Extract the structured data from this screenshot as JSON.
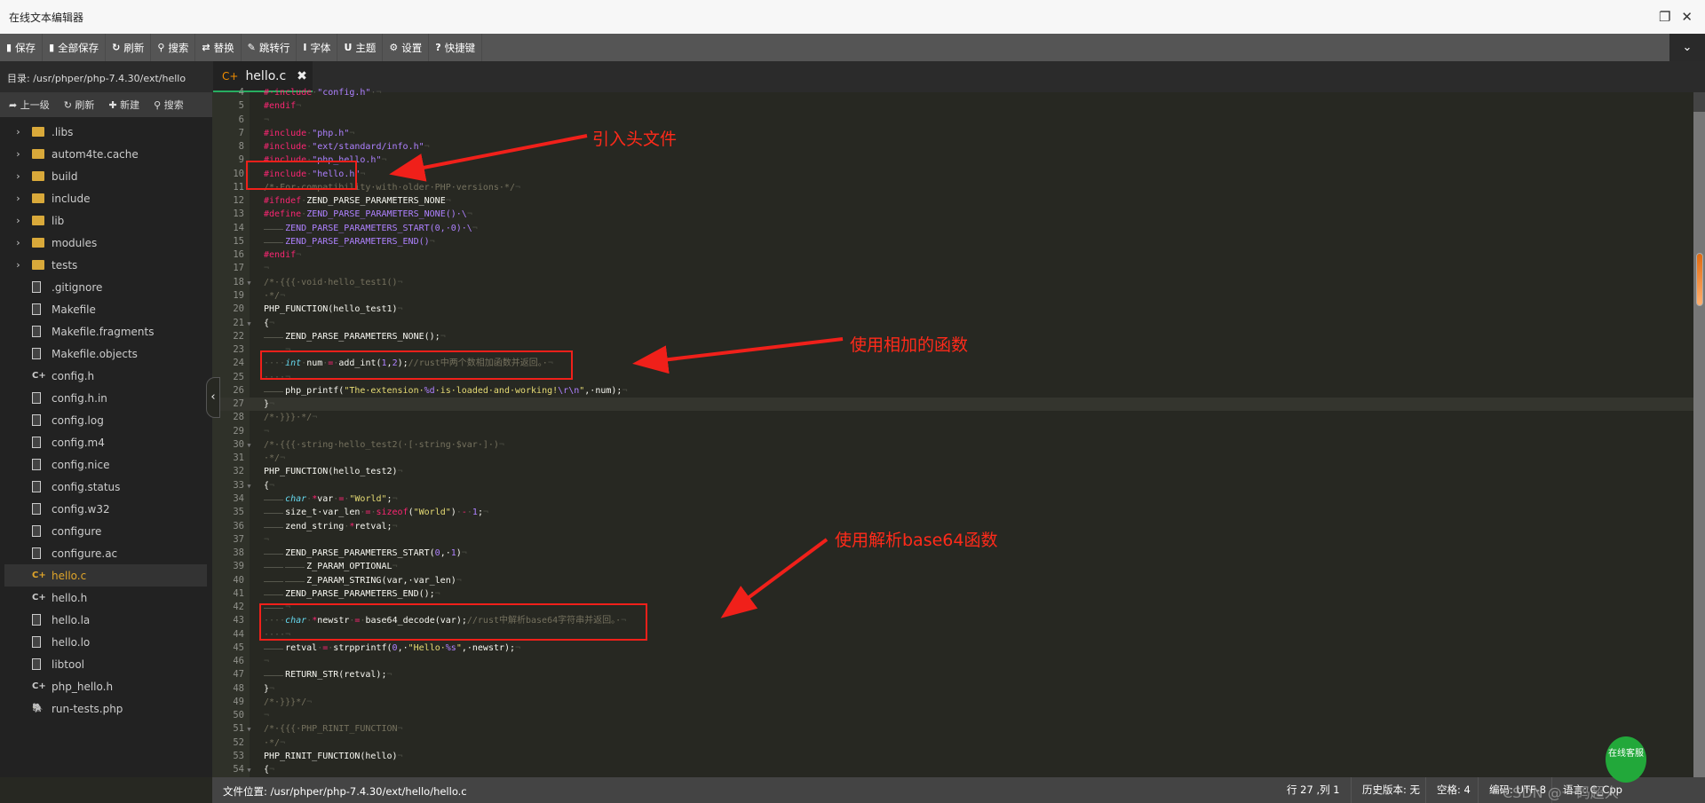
{
  "window": {
    "title": "在线文本编辑器",
    "restore_icon": "restore-icon",
    "close_icon": "close-icon"
  },
  "toolbar": [
    {
      "icon": "save-icon",
      "glyph": "▮",
      "label": "保存"
    },
    {
      "icon": "save-all-icon",
      "glyph": "▮",
      "label": "全部保存"
    },
    {
      "icon": "refresh-icon",
      "glyph": "↻",
      "label": "刷新"
    },
    {
      "icon": "search-icon",
      "glyph": "⚲",
      "label": "搜索"
    },
    {
      "icon": "replace-icon",
      "glyph": "⇄",
      "label": "替换"
    },
    {
      "icon": "pin-icon",
      "glyph": "✎",
      "label": "跳转行"
    },
    {
      "icon": "font-icon",
      "glyph": "I",
      "label": "字体"
    },
    {
      "icon": "magnet-icon",
      "glyph": "U",
      "label": "主题"
    },
    {
      "icon": "gear-icon",
      "glyph": "⚙",
      "label": "设置"
    },
    {
      "icon": "help-icon",
      "glyph": "?",
      "label": "快捷键"
    }
  ],
  "sidebar": {
    "directory": "目录: /usr/phper/php-7.4.30/ext/hello",
    "tools": [
      {
        "icon": "up-icon",
        "label": "➦ 上一级"
      },
      {
        "icon": "refresh-icon",
        "label": "↻ 刷新"
      },
      {
        "icon": "plus-icon",
        "label": "✚ 新建"
      },
      {
        "icon": "search-icon",
        "label": "⚲ 搜索"
      }
    ],
    "items": [
      {
        "name": ".libs",
        "type": "folder"
      },
      {
        "name": "autom4te.cache",
        "type": "folder"
      },
      {
        "name": "build",
        "type": "folder"
      },
      {
        "name": "include",
        "type": "folder"
      },
      {
        "name": "lib",
        "type": "folder"
      },
      {
        "name": "modules",
        "type": "folder"
      },
      {
        "name": "tests",
        "type": "folder"
      },
      {
        "name": ".gitignore",
        "type": "file"
      },
      {
        "name": "Makefile",
        "type": "file"
      },
      {
        "name": "Makefile.fragments",
        "type": "file"
      },
      {
        "name": "Makefile.objects",
        "type": "file"
      },
      {
        "name": "config.h",
        "type": "cpp"
      },
      {
        "name": "config.h.in",
        "type": "file"
      },
      {
        "name": "config.log",
        "type": "file"
      },
      {
        "name": "config.m4",
        "type": "file"
      },
      {
        "name": "config.nice",
        "type": "file"
      },
      {
        "name": "config.status",
        "type": "file"
      },
      {
        "name": "config.w32",
        "type": "file"
      },
      {
        "name": "configure",
        "type": "file"
      },
      {
        "name": "configure.ac",
        "type": "file"
      },
      {
        "name": "hello.c",
        "type": "cpp",
        "active": true
      },
      {
        "name": "hello.h",
        "type": "cpp"
      },
      {
        "name": "hello.la",
        "type": "file"
      },
      {
        "name": "hello.lo",
        "type": "file"
      },
      {
        "name": "libtool",
        "type": "file"
      },
      {
        "name": "php_hello.h",
        "type": "cpp"
      },
      {
        "name": "run-tests.php",
        "type": "php"
      }
    ]
  },
  "tab": {
    "label": "hello.c",
    "icon": "cpp-file-icon",
    "close": "✖"
  },
  "editor": {
    "current_line": 27,
    "lines": [
      {
        "n": 4,
        "t": [
          [
            "p",
            "#·include"
          ],
          [
            "d",
            "·"
          ],
          [
            "s",
            "\"config.h\""
          ],
          [
            "d",
            "·"
          ],
          [
            "e",
            "¬"
          ]
        ]
      },
      {
        "n": 5,
        "t": [
          [
            "p",
            "#endif"
          ],
          [
            "e",
            "¬"
          ]
        ]
      },
      {
        "n": 6,
        "t": [
          [
            "e",
            "¬"
          ]
        ]
      },
      {
        "n": 7,
        "t": [
          [
            "p",
            "#include"
          ],
          [
            "d",
            "·"
          ],
          [
            "s",
            "\"php.h\""
          ],
          [
            "e",
            "¬"
          ]
        ]
      },
      {
        "n": 8,
        "t": [
          [
            "p",
            "#include"
          ],
          [
            "d",
            "·"
          ],
          [
            "s",
            "\"ext/standard/info.h\""
          ],
          [
            "e",
            "¬"
          ]
        ]
      },
      {
        "n": 9,
        "t": [
          [
            "p",
            "#include"
          ],
          [
            "d",
            "·"
          ],
          [
            "s",
            "\"php_hello.h\""
          ],
          [
            "e",
            "¬"
          ]
        ]
      },
      {
        "n": 10,
        "t": [
          [
            "p",
            "#include"
          ],
          [
            "d",
            "·"
          ],
          [
            "s",
            "\"hello.h\""
          ],
          [
            "e",
            "¬"
          ]
        ]
      },
      {
        "n": 11,
        "t": [
          [
            "c",
            "/*·For·compatibility·with·older·PHP·versions·*/"
          ],
          [
            "e",
            "¬"
          ]
        ]
      },
      {
        "n": 12,
        "t": [
          [
            "p",
            "#ifndef"
          ],
          [
            "d",
            "·"
          ],
          [
            "w",
            "ZEND_PARSE_PARAMETERS_NONE"
          ],
          [
            "e",
            "¬"
          ]
        ]
      },
      {
        "n": 13,
        "t": [
          [
            "p",
            "#define"
          ],
          [
            "d",
            "·"
          ],
          [
            "s",
            "ZEND_PARSE_PARAMETERS_NONE()·\\"
          ],
          [
            "e",
            "¬"
          ]
        ]
      },
      {
        "n": 14,
        "t": [
          [
            "t",
            ""
          ],
          [
            "s",
            "ZEND_PARSE_PARAMETERS_START(0,·0)·\\"
          ],
          [
            "e",
            "¬"
          ]
        ]
      },
      {
        "n": 15,
        "t": [
          [
            "t",
            ""
          ],
          [
            "s",
            "ZEND_PARSE_PARAMETERS_END()"
          ],
          [
            "e",
            "¬"
          ]
        ]
      },
      {
        "n": 16,
        "t": [
          [
            "p",
            "#endif"
          ],
          [
            "e",
            "¬"
          ]
        ]
      },
      {
        "n": 17,
        "t": [
          [
            "e",
            "¬"
          ]
        ]
      },
      {
        "n": 18,
        "fold": true,
        "t": [
          [
            "c",
            "/*·{{{·void·hello_test1()"
          ],
          [
            "e",
            "¬"
          ]
        ]
      },
      {
        "n": 19,
        "t": [
          [
            "c",
            "·*/"
          ],
          [
            "e",
            "¬"
          ]
        ]
      },
      {
        "n": 20,
        "t": [
          [
            "w",
            "PHP_FUNCTION(hello_test1)"
          ],
          [
            "e",
            "¬"
          ]
        ]
      },
      {
        "n": 21,
        "fold": true,
        "t": [
          [
            "w",
            "{"
          ],
          [
            "e",
            "¬"
          ]
        ]
      },
      {
        "n": 22,
        "t": [
          [
            "t",
            ""
          ],
          [
            "w",
            "ZEND_PARSE_PARAMETERS_NONE();"
          ],
          [
            "e",
            "¬"
          ]
        ]
      },
      {
        "n": 23,
        "t": [
          [
            "t",
            ""
          ],
          [
            "e",
            "¬"
          ]
        ]
      },
      {
        "n": 24,
        "t": [
          [
            "d",
            "····"
          ],
          [
            "k",
            "int"
          ],
          [
            "d",
            "·"
          ],
          [
            "w",
            "num"
          ],
          [
            "d",
            "·"
          ],
          [
            "o",
            "="
          ],
          [
            "d",
            "·"
          ],
          [
            "w",
            "add_int("
          ],
          [
            "n",
            "1"
          ],
          [
            "w",
            ","
          ],
          [
            "n",
            "2"
          ],
          [
            "w",
            ");"
          ],
          [
            "c",
            "//rust中两个数相加函数并返回。·"
          ],
          [
            "e",
            "¬"
          ]
        ]
      },
      {
        "n": 25,
        "t": [
          [
            "d",
            "····"
          ],
          [
            "e",
            "¬"
          ]
        ]
      },
      {
        "n": 26,
        "t": [
          [
            "t",
            ""
          ],
          [
            "w",
            "php_printf("
          ],
          [
            "y",
            "\"The·extension·"
          ],
          [
            "n",
            "%d"
          ],
          [
            "y",
            "·is·loaded·and·working!"
          ],
          [
            "n",
            "\\r\\n"
          ],
          [
            "y",
            "\""
          ],
          [
            "w",
            ",·num);"
          ],
          [
            "e",
            "¬"
          ]
        ]
      },
      {
        "n": 27,
        "t": [
          [
            "w",
            "}"
          ],
          [
            "e",
            "¬"
          ]
        ]
      },
      {
        "n": 28,
        "t": [
          [
            "c",
            "/*·}}}·*/"
          ],
          [
            "e",
            "¬"
          ]
        ]
      },
      {
        "n": 29,
        "t": [
          [
            "e",
            "¬"
          ]
        ]
      },
      {
        "n": 30,
        "fold": true,
        "t": [
          [
            "c",
            "/*·{{{·string·hello_test2(·[·string·$var·]·)"
          ],
          [
            "e",
            "¬"
          ]
        ]
      },
      {
        "n": 31,
        "t": [
          [
            "c",
            "·*/"
          ],
          [
            "e",
            "¬"
          ]
        ]
      },
      {
        "n": 32,
        "t": [
          [
            "w",
            "PHP_FUNCTION(hello_test2)"
          ],
          [
            "e",
            "¬"
          ]
        ]
      },
      {
        "n": 33,
        "fold": true,
        "t": [
          [
            "w",
            "{"
          ],
          [
            "e",
            "¬"
          ]
        ]
      },
      {
        "n": 34,
        "t": [
          [
            "t",
            ""
          ],
          [
            "k",
            "char"
          ],
          [
            "d",
            "·"
          ],
          [
            "o",
            "*"
          ],
          [
            "w",
            "var"
          ],
          [
            "d",
            "·"
          ],
          [
            "o",
            "="
          ],
          [
            "d",
            "·"
          ],
          [
            "y",
            "\"World\""
          ],
          [
            "w",
            ";"
          ],
          [
            "e",
            "¬"
          ]
        ]
      },
      {
        "n": 35,
        "t": [
          [
            "t",
            ""
          ],
          [
            "w",
            "size_t·var_len"
          ],
          [
            "d",
            "·"
          ],
          [
            "o",
            "="
          ],
          [
            "d",
            "·"
          ],
          [
            "o",
            "sizeof"
          ],
          [
            "w",
            "("
          ],
          [
            "y",
            "\"World\""
          ],
          [
            "w",
            ")"
          ],
          [
            "d",
            "·"
          ],
          [
            "o",
            "-"
          ],
          [
            "d",
            "·"
          ],
          [
            "n",
            "1"
          ],
          [
            "w",
            ";"
          ],
          [
            "e",
            "¬"
          ]
        ]
      },
      {
        "n": 36,
        "t": [
          [
            "t",
            ""
          ],
          [
            "w",
            "zend_string"
          ],
          [
            "d",
            "·"
          ],
          [
            "o",
            "*"
          ],
          [
            "w",
            "retval;"
          ],
          [
            "e",
            "¬"
          ]
        ]
      },
      {
        "n": 37,
        "t": [
          [
            "e",
            "¬"
          ]
        ]
      },
      {
        "n": 38,
        "t": [
          [
            "t",
            ""
          ],
          [
            "w",
            "ZEND_PARSE_PARAMETERS_START("
          ],
          [
            "n",
            "0"
          ],
          [
            "w",
            ",·"
          ],
          [
            "n",
            "1"
          ],
          [
            "w",
            ")"
          ],
          [
            "e",
            "¬"
          ]
        ]
      },
      {
        "n": 39,
        "t": [
          [
            "t",
            ""
          ],
          [
            "t",
            ""
          ],
          [
            "w",
            "Z_PARAM_OPTIONAL"
          ],
          [
            "e",
            "¬"
          ]
        ]
      },
      {
        "n": 40,
        "t": [
          [
            "t",
            ""
          ],
          [
            "t",
            ""
          ],
          [
            "w",
            "Z_PARAM_STRING(var,·var_len)"
          ],
          [
            "e",
            "¬"
          ]
        ]
      },
      {
        "n": 41,
        "t": [
          [
            "t",
            ""
          ],
          [
            "w",
            "ZEND_PARSE_PARAMETERS_END();"
          ],
          [
            "e",
            "¬"
          ]
        ]
      },
      {
        "n": 42,
        "t": [
          [
            "t",
            ""
          ],
          [
            "e",
            "¬"
          ]
        ]
      },
      {
        "n": 43,
        "t": [
          [
            "d",
            "····"
          ],
          [
            "k",
            "char"
          ],
          [
            "d",
            "·"
          ],
          [
            "o",
            "*"
          ],
          [
            "w",
            "newstr"
          ],
          [
            "d",
            "·"
          ],
          [
            "o",
            "="
          ],
          [
            "d",
            "·"
          ],
          [
            "w",
            "base64_decode(var);"
          ],
          [
            "c",
            "//rust中解析base64字符串并返回。·"
          ],
          [
            "e",
            "¬"
          ]
        ]
      },
      {
        "n": 44,
        "t": [
          [
            "d",
            "····"
          ],
          [
            "e",
            "¬"
          ]
        ]
      },
      {
        "n": 45,
        "t": [
          [
            "t",
            ""
          ],
          [
            "w",
            "retval"
          ],
          [
            "d",
            "·"
          ],
          [
            "o",
            "="
          ],
          [
            "d",
            "·"
          ],
          [
            "w",
            "strpprintf("
          ],
          [
            "n",
            "0"
          ],
          [
            "w",
            ",·"
          ],
          [
            "y",
            "\"Hello·"
          ],
          [
            "n",
            "%s"
          ],
          [
            "y",
            "\""
          ],
          [
            "w",
            ",·newstr);"
          ],
          [
            "e",
            "¬"
          ]
        ]
      },
      {
        "n": 46,
        "t": [
          [
            "e",
            "¬"
          ]
        ]
      },
      {
        "n": 47,
        "t": [
          [
            "t",
            ""
          ],
          [
            "w",
            "RETURN_STR(retval);"
          ],
          [
            "e",
            "¬"
          ]
        ]
      },
      {
        "n": 48,
        "t": [
          [
            "w",
            "}"
          ],
          [
            "e",
            "¬"
          ]
        ]
      },
      {
        "n": 49,
        "t": [
          [
            "c",
            "/*·}}}*/"
          ],
          [
            "e",
            "¬"
          ]
        ]
      },
      {
        "n": 50,
        "t": [
          [
            "e",
            "¬"
          ]
        ]
      },
      {
        "n": 51,
        "fold": true,
        "t": [
          [
            "c",
            "/*·{{{·PHP_RINIT_FUNCTION"
          ],
          [
            "e",
            "¬"
          ]
        ]
      },
      {
        "n": 52,
        "t": [
          [
            "c",
            "·*/"
          ],
          [
            "e",
            "¬"
          ]
        ]
      },
      {
        "n": 53,
        "t": [
          [
            "w",
            "PHP_RINIT_FUNCTION(hello)"
          ],
          [
            "e",
            "¬"
          ]
        ]
      },
      {
        "n": 54,
        "fold": true,
        "t": [
          [
            "w",
            "{"
          ],
          [
            "e",
            "¬"
          ]
        ]
      }
    ]
  },
  "annotations": {
    "color": "#f0201a",
    "include_header": "引入头文件",
    "add_func": "使用相加的函数",
    "base64_func": "使用解析base64函数"
  },
  "statusbar": {
    "path": "文件位置: /usr/phper/php-7.4.30/ext/hello/hello.c",
    "position": "行 27 ,列 1",
    "history": "历史版本: 无",
    "spaces": "空格: 4",
    "encoding": "编码: UTF-8",
    "language": "语言: C_Cpp"
  },
  "chat_widget": "在线客服",
  "watermark": "CSDN @一码超人",
  "scroll": {
    "position_fraction": 0.25
  }
}
